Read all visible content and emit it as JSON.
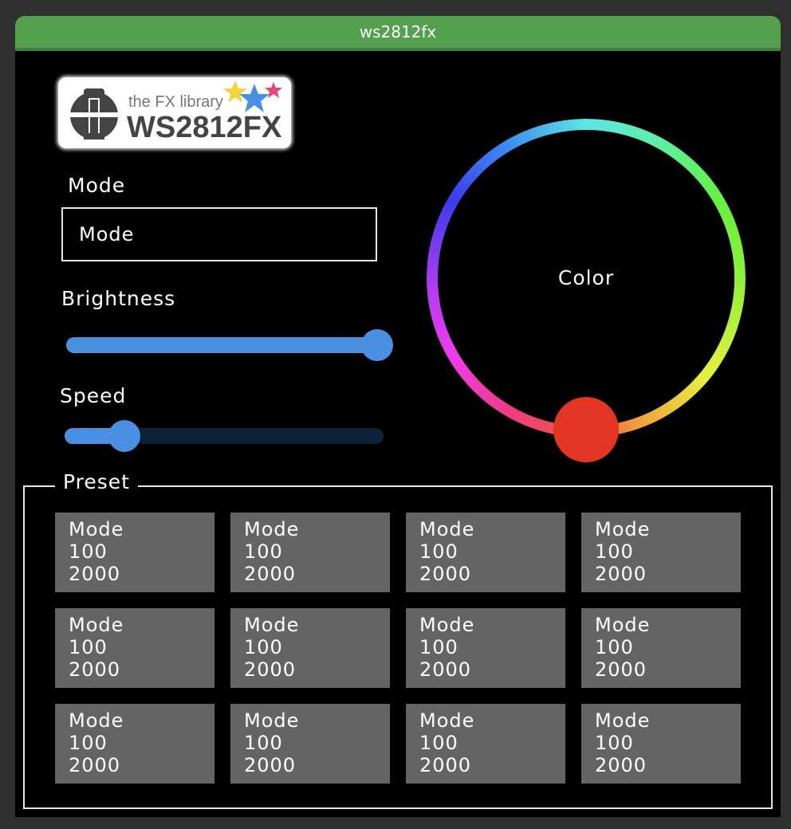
{
  "window": {
    "title": "ws2812fx"
  },
  "logo": {
    "tagline": "the FX library",
    "brand": "WS2812FX"
  },
  "mode": {
    "label": "Mode",
    "value": "Mode"
  },
  "brightness": {
    "label": "Brightness",
    "value_fraction": 1.0
  },
  "speed": {
    "label": "Speed",
    "value_fraction": 0.17
  },
  "color": {
    "label": "Color",
    "selected": "#e43424"
  },
  "preset": {
    "legend": "Preset",
    "buttons": [
      {
        "mode": "Mode",
        "brightness": "100",
        "speed": "2000"
      },
      {
        "mode": "Mode",
        "brightness": "100",
        "speed": "2000"
      },
      {
        "mode": "Mode",
        "brightness": "100",
        "speed": "2000"
      },
      {
        "mode": "Mode",
        "brightness": "100",
        "speed": "2000"
      },
      {
        "mode": "Mode",
        "brightness": "100",
        "speed": "2000"
      },
      {
        "mode": "Mode",
        "brightness": "100",
        "speed": "2000"
      },
      {
        "mode": "Mode",
        "brightness": "100",
        "speed": "2000"
      },
      {
        "mode": "Mode",
        "brightness": "100",
        "speed": "2000"
      },
      {
        "mode": "Mode",
        "brightness": "100",
        "speed": "2000"
      },
      {
        "mode": "Mode",
        "brightness": "100",
        "speed": "2000"
      },
      {
        "mode": "Mode",
        "brightness": "100",
        "speed": "2000"
      },
      {
        "mode": "Mode",
        "brightness": "100",
        "speed": "2000"
      }
    ]
  },
  "colors": {
    "titlebar": "#55a04f",
    "accent": "#4a90e2",
    "slider_track_inactive": "#0d2236",
    "preset_button": "#646464"
  }
}
